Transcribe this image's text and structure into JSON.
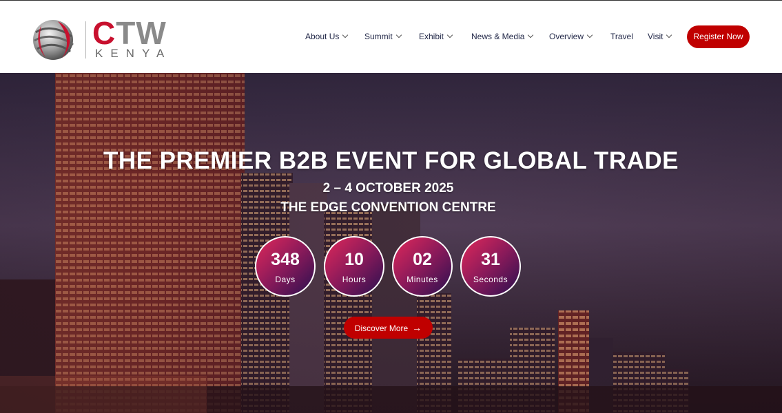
{
  "brand": {
    "name_prefix": "C",
    "name_suffix": "TW",
    "subtitle": "KENYA",
    "colors": {
      "primary_red": "#c00000",
      "navy": "#222848"
    }
  },
  "nav": {
    "items": [
      {
        "label": "About Us",
        "has_dropdown": true
      },
      {
        "label": "Summit",
        "has_dropdown": true
      },
      {
        "label": "Exhibit",
        "has_dropdown": true
      },
      {
        "label": "News & Media",
        "has_dropdown": true
      },
      {
        "label": "Overview",
        "has_dropdown": true
      },
      {
        "label": "Travel",
        "has_dropdown": false
      },
      {
        "label": "Visit",
        "has_dropdown": true
      }
    ],
    "cta_label": "Register Now"
  },
  "hero": {
    "title": "THE PREMIER B2B EVENT FOR GLOBAL TRADE",
    "date": "2 – 4 OCTOBER 2025",
    "venue": "THE EDGE CONVENTION CENTRE",
    "countdown": [
      {
        "value": "348",
        "label": "Days"
      },
      {
        "value": "10",
        "label": "Hours"
      },
      {
        "value": "02",
        "label": "Minutes"
      },
      {
        "value": "31",
        "label": "Seconds"
      }
    ],
    "cta_label": "Discover More",
    "cta_icon": "arrow-right-icon"
  }
}
